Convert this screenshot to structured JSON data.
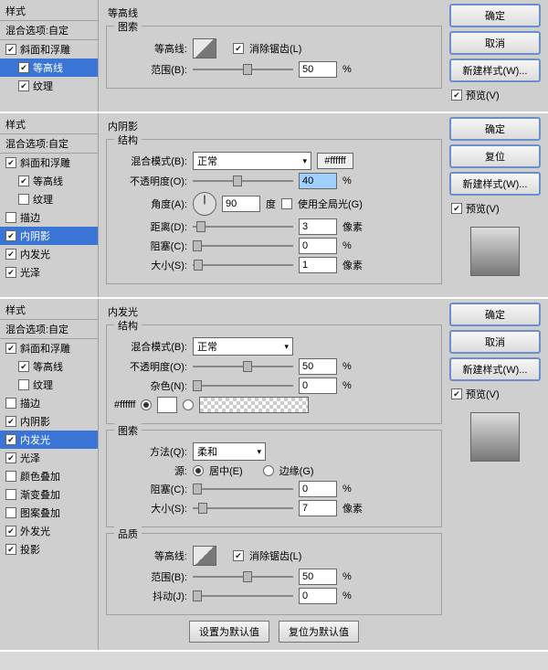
{
  "common": {
    "styles_header": "样式",
    "blend_options": "混合选项:自定",
    "ok": "确定",
    "cancel": "取消",
    "reset": "复位",
    "new_style": "新建样式(W)...",
    "preview": "预览(V)"
  },
  "p1": {
    "title": "等高线",
    "items": [
      {
        "label": "斜面和浮雕",
        "checked": true,
        "sub": false,
        "sel": false
      },
      {
        "label": "等高线",
        "checked": true,
        "sub": true,
        "sel": true
      },
      {
        "label": "纹理",
        "checked": true,
        "sub": true,
        "sel": false
      }
    ],
    "g1": "图索",
    "contour_label": "等高线:",
    "antialias": "消除锯齿(L)",
    "range": "范围(B):",
    "range_val": "50",
    "pct": "%"
  },
  "p2": {
    "title": "内阴影",
    "items": [
      {
        "label": "斜面和浮雕",
        "checked": true,
        "sub": false,
        "sel": false
      },
      {
        "label": "等高线",
        "checked": true,
        "sub": true,
        "sel": false
      },
      {
        "label": "纹理",
        "checked": false,
        "sub": true,
        "sel": false
      },
      {
        "label": "描边",
        "checked": false,
        "sub": false,
        "sel": false
      },
      {
        "label": "内阴影",
        "checked": true,
        "sub": false,
        "sel": true
      },
      {
        "label": "内发光",
        "checked": true,
        "sub": false,
        "sel": false
      },
      {
        "label": "光泽",
        "checked": true,
        "sub": false,
        "sel": false
      }
    ],
    "g1": "结构",
    "blend_mode": "混合模式(B):",
    "blend_val": "正常",
    "color": "#ffffff",
    "opacity": "不透明度(O):",
    "opacity_val": "40",
    "pct": "%",
    "angle": "角度(A):",
    "angle_val": "90",
    "deg": "度",
    "global": "使用全局光(G)",
    "distance": "距离(D):",
    "distance_val": "3",
    "px": "像素",
    "choke": "阻塞(C):",
    "choke_val": "0",
    "size": "大小(S):",
    "size_val": "1"
  },
  "p3": {
    "title": "内发光",
    "items": [
      {
        "label": "斜面和浮雕",
        "checked": true,
        "sub": false,
        "sel": false
      },
      {
        "label": "等高线",
        "checked": true,
        "sub": true,
        "sel": false
      },
      {
        "label": "纹理",
        "checked": false,
        "sub": true,
        "sel": false
      },
      {
        "label": "描边",
        "checked": false,
        "sub": false,
        "sel": false
      },
      {
        "label": "内阴影",
        "checked": true,
        "sub": false,
        "sel": false
      },
      {
        "label": "内发光",
        "checked": true,
        "sub": false,
        "sel": true
      },
      {
        "label": "光泽",
        "checked": true,
        "sub": false,
        "sel": false
      },
      {
        "label": "颜色叠加",
        "checked": false,
        "sub": false,
        "sel": false
      },
      {
        "label": "渐变叠加",
        "checked": false,
        "sub": false,
        "sel": false
      },
      {
        "label": "图案叠加",
        "checked": false,
        "sub": false,
        "sel": false
      },
      {
        "label": "外发光",
        "checked": true,
        "sub": false,
        "sel": false
      },
      {
        "label": "投影",
        "checked": true,
        "sub": false,
        "sel": false
      }
    ],
    "g1": "结构",
    "blend_mode": "混合模式(B):",
    "blend_val": "正常",
    "opacity": "不透明度(O):",
    "opacity_val": "50",
    "pct": "%",
    "noise": "杂色(N):",
    "noise_val": "0",
    "color": "#ffffff",
    "g2": "图索",
    "method": "方法(Q):",
    "method_val": "柔和",
    "source": "源:",
    "src_center": "居中(E)",
    "src_edge": "边缘(G)",
    "choke": "阻塞(C):",
    "choke_val": "0",
    "size": "大小(S):",
    "size_val": "7",
    "px": "像素",
    "g3": "品质",
    "contour": "等高线:",
    "antialias": "消除锯齿(L)",
    "range": "范围(B):",
    "range_val": "50",
    "jitter": "抖动(J):",
    "jitter_val": "0",
    "set_default": "设置为默认值",
    "reset_default": "复位为默认值"
  }
}
